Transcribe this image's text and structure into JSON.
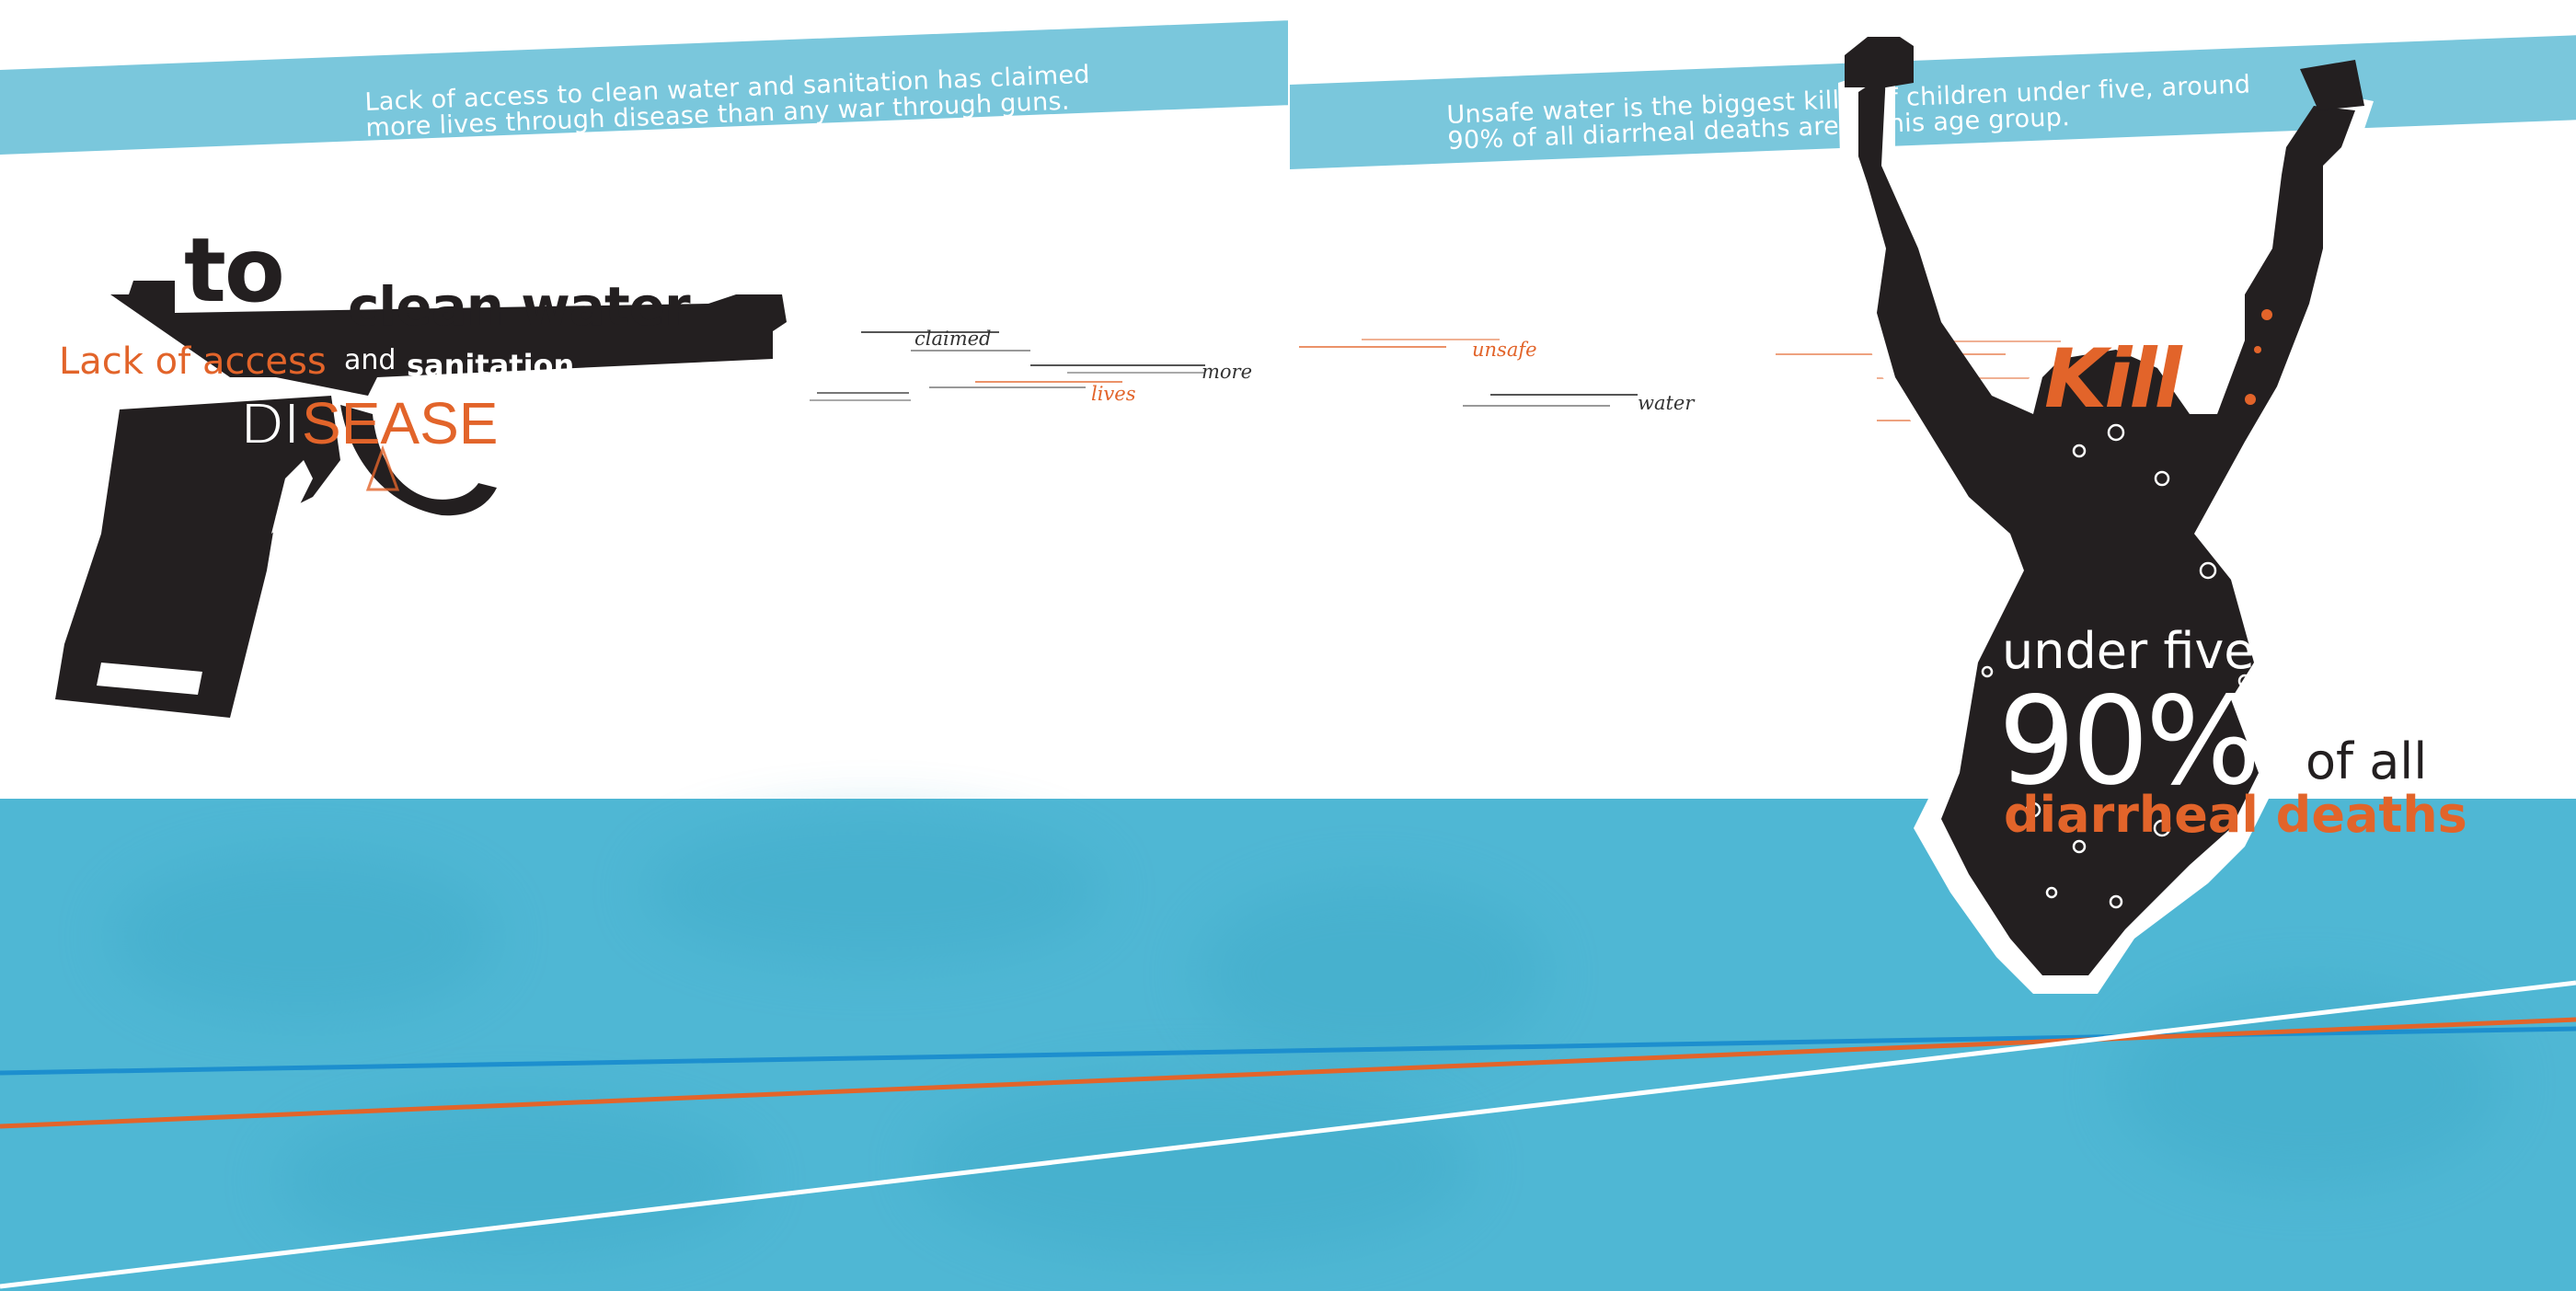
{
  "banners": {
    "left": "Lack of access to clean water and sanitation has claimed more lives through disease than any war through guns.",
    "right": "Unsafe water is the biggest killer of children under five, around 90% of all diarrheal deaths are in this age group."
  },
  "gun_text": {
    "to": "to",
    "clean_water": "clean water",
    "lack_of_access": "Lack of access",
    "and": "and",
    "sanitation": "sanitation",
    "di": "DI",
    "sease": "SEASE",
    "a": "A"
  },
  "speed_words": {
    "claimed": "claimed",
    "more": "more",
    "lives": "lives",
    "unsafe": "unsafe",
    "water": "water"
  },
  "figure_text": {
    "kill": "Kill",
    "under_five": "under five",
    "percent": "90%",
    "of_all": "of all",
    "diarrheal_deaths": "diarrheal deaths"
  },
  "colors": {
    "orange": "#e2642a",
    "banner": "#7ac7dc",
    "water": "#4fb7d4",
    "silhouette": "#231f20"
  }
}
